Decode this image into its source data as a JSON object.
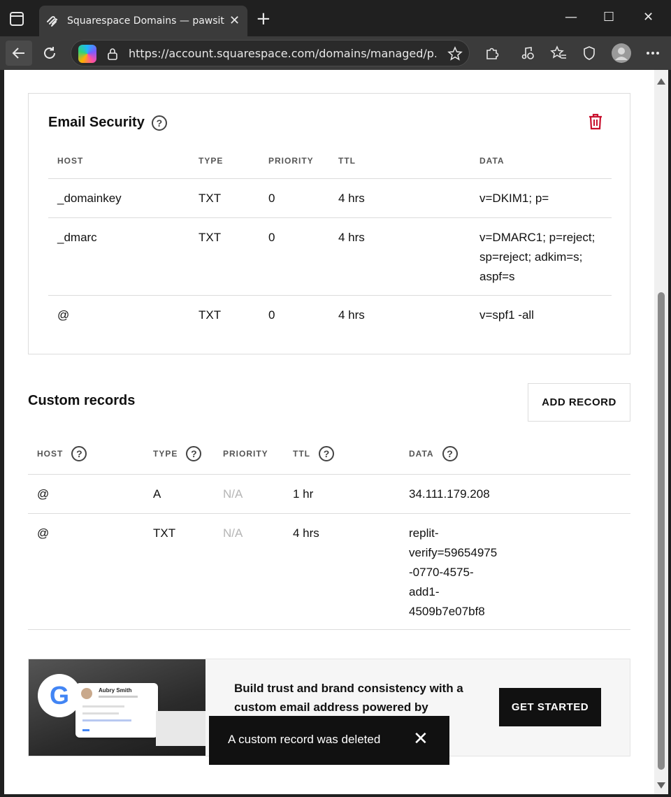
{
  "browser": {
    "tab_title": "Squarespace Domains — pawsitiv",
    "tab_close": "✕",
    "new_tab": "+",
    "url": "https://account.squarespace.com/domains/managed/p...",
    "window_min": "—",
    "window_max": "☐",
    "window_close": "✕"
  },
  "email_security": {
    "title": "Email Security",
    "help": "?",
    "columns": [
      "HOST",
      "TYPE",
      "PRIORITY",
      "TTL",
      "DATA"
    ],
    "rows": [
      {
        "host": "_domainkey",
        "type": "TXT",
        "priority": "0",
        "ttl": "4 hrs",
        "data": [
          "v=DKIM1; p="
        ]
      },
      {
        "host": "_dmarc",
        "type": "TXT",
        "priority": "0",
        "ttl": "4 hrs",
        "data": [
          "v=DMARC1; p=reject;",
          "sp=reject; adkim=s;",
          "aspf=s"
        ]
      },
      {
        "host": "@",
        "type": "TXT",
        "priority": "0",
        "ttl": "4 hrs",
        "data": [
          "v=spf1 -all"
        ]
      }
    ]
  },
  "custom_records": {
    "title": "Custom records",
    "add_button": "ADD RECORD",
    "help": "?",
    "columns": [
      "HOST",
      "TYPE",
      "PRIORITY",
      "TTL",
      "DATA"
    ],
    "rows": [
      {
        "host": "@",
        "type": "A",
        "priority": "N/A",
        "ttl": "1 hr",
        "data": [
          "34.111.179.208"
        ]
      },
      {
        "host": "@",
        "type": "TXT",
        "priority": "N/A",
        "ttl": "4 hrs",
        "data": [
          "replit-",
          "verify=59654975",
          "-0770-4575-",
          "add1-",
          "4509b7e07bf8"
        ]
      }
    ]
  },
  "promo": {
    "text_line1": "Build trust and brand consistency with a",
    "text_line2": "custom email address powered by",
    "button": "GET STARTED",
    "contact_name": "Aubry Smith",
    "google_letter": "G"
  },
  "toast": {
    "message": "A custom record was deleted",
    "close": "✕"
  },
  "colors": {
    "delete_icon": "#c8102e",
    "button_dark": "#111111",
    "na_text": "#b5b5b5"
  }
}
